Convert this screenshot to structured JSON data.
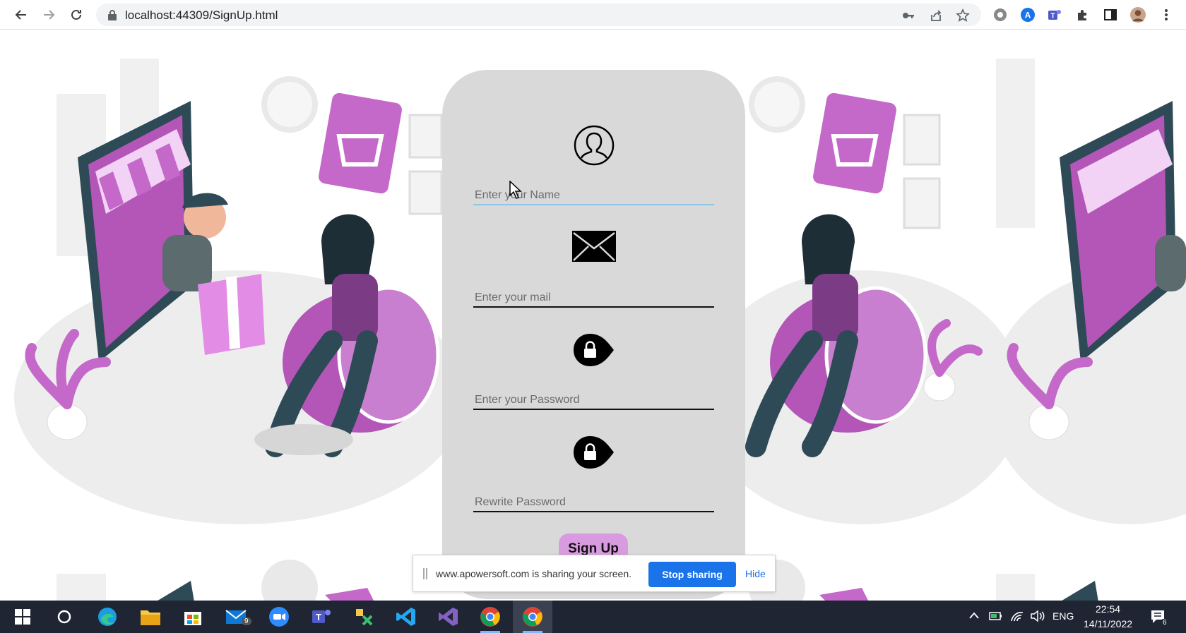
{
  "browser": {
    "url": "localhost:44309/SignUp.html",
    "accent": "#1a73e8"
  },
  "form": {
    "name_placeholder": "Enter your Name",
    "mail_placeholder": "Enter your mail",
    "password_placeholder": "Enter your Password",
    "rewrite_placeholder": "Rewrite Password",
    "signup_label": "Sign Up",
    "card_color": "#d9d9d9",
    "button_color": "#d99be0"
  },
  "share_bar": {
    "message": "www.apowersoft.com is sharing your screen.",
    "stop_label": "Stop sharing",
    "hide_label": "Hide"
  },
  "taskbar": {
    "mail_badge": "9",
    "language": "ENG",
    "time": "22:54",
    "date": "14/11/2022",
    "notification_count": "6",
    "apps": [
      "windows-start",
      "search",
      "edge",
      "file-explorer",
      "store",
      "mail",
      "zoom",
      "teams",
      "snip",
      "vscode",
      "visual-studio",
      "chrome",
      "chrome"
    ]
  }
}
